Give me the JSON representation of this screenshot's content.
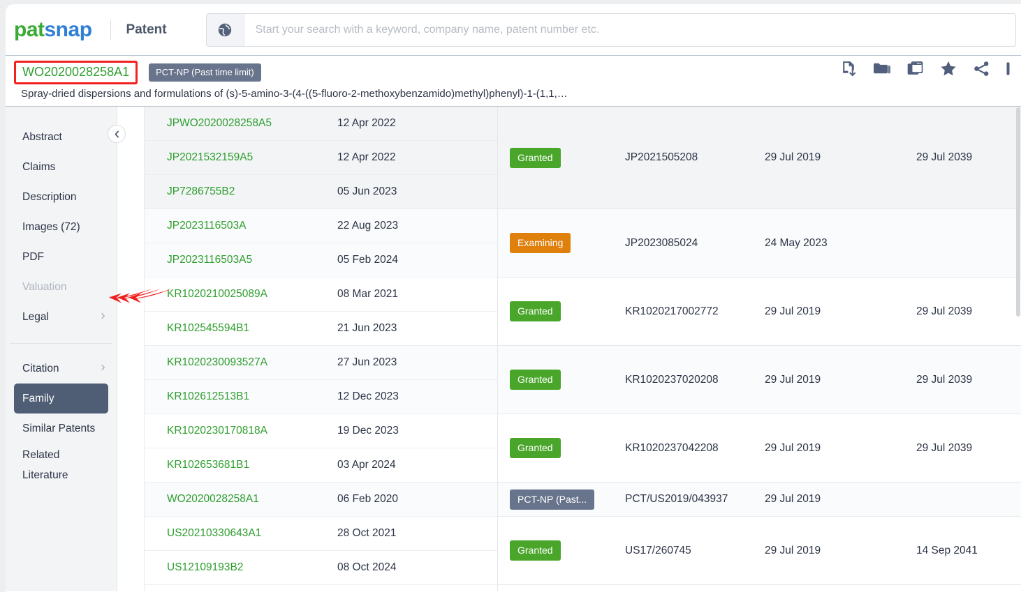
{
  "brand": {
    "pat": "pat",
    "snap": "snap",
    "nav_label": "Patent"
  },
  "search": {
    "placeholder": "Start your search with a keyword, company name, patent number etc.",
    "value": "",
    "globe_icon": "globe-icon"
  },
  "patent_header": {
    "number": "WO2020028258A1",
    "status_chip": "PCT-NP (Past time limit)",
    "title": "Spray-dried dispersions and formulations of (s)-5-amino-3-(4-((5-fluoro-2-methoxybenzamido)methyl)phenyl)-1-(1,1,…",
    "icons": [
      {
        "name": "pdf-download-icon",
        "label": "PDF"
      },
      {
        "name": "folder-icon",
        "label": "Folder"
      },
      {
        "name": "window-copy-icon",
        "label": "Workspace"
      },
      {
        "name": "star-icon",
        "label": "Favorite"
      },
      {
        "name": "share-icon",
        "label": "Share"
      },
      {
        "name": "more-icon",
        "label": "More"
      }
    ]
  },
  "sidebar": {
    "collapse_icon": "chevron-left-icon",
    "items": [
      {
        "label": "Abstract",
        "state": "normal",
        "chevron": false
      },
      {
        "label": "Claims",
        "state": "normal",
        "chevron": false
      },
      {
        "label": "Description",
        "state": "normal",
        "chevron": false
      },
      {
        "label": "Images (72)",
        "state": "normal",
        "chevron": false
      },
      {
        "label": "PDF",
        "state": "normal",
        "chevron": false
      },
      {
        "label": "Valuation",
        "state": "disabled",
        "chevron": false
      },
      {
        "label": "Legal",
        "state": "normal",
        "chevron": true
      }
    ],
    "items2": [
      {
        "label": "Citation",
        "state": "normal",
        "chevron": true
      },
      {
        "label": "Family",
        "state": "active",
        "chevron": false
      },
      {
        "label": "Similar Patents",
        "state": "normal",
        "chevron": false
      },
      {
        "label": "Related Literature",
        "state": "normal",
        "chevron": false,
        "wrap": true
      }
    ]
  },
  "family_table": {
    "publications": [
      {
        "number": "JPWO2020028258A5",
        "date": "12 Apr 2022",
        "arrow": false,
        "shade": "a"
      },
      {
        "number": "JP2021532159A5",
        "date": "12 Apr 2022",
        "arrow": false,
        "shade": "a"
      },
      {
        "number": "JP7286755B2",
        "date": "05 Jun 2023",
        "arrow": true,
        "shade": "a"
      },
      {
        "number": "JP2023116503A",
        "date": "22 Aug 2023",
        "arrow": false,
        "shade": "b"
      },
      {
        "number": "JP2023116503A5",
        "date": "05 Feb 2024",
        "arrow": false,
        "shade": "b"
      },
      {
        "number": "KR1020210025089A",
        "date": "08 Mar 2021",
        "arrow": false,
        "shade": "c"
      },
      {
        "number": "KR102545594B1",
        "date": "21 Jun 2023",
        "arrow": true,
        "shade": "c"
      },
      {
        "number": "KR1020230093527A",
        "date": "27 Jun 2023",
        "arrow": false,
        "shade": "b"
      },
      {
        "number": "KR102612513B1",
        "date": "12 Dec 2023",
        "arrow": false,
        "shade": "b"
      },
      {
        "number": "KR1020230170818A",
        "date": "19 Dec 2023",
        "arrow": false,
        "shade": "c"
      },
      {
        "number": "KR102653681B1",
        "date": "03 Apr 2024",
        "arrow": false,
        "shade": "c"
      },
      {
        "number": "WO2020028258A1",
        "date": "06 Feb 2020",
        "arrow": false,
        "shade": "b"
      },
      {
        "number": "US20210330643A1",
        "date": "28 Oct 2021",
        "arrow": false,
        "shade": "c"
      },
      {
        "number": "US12109193B2",
        "date": "08 Oct 2024",
        "arrow": true,
        "shade": "c"
      }
    ],
    "groups": [
      {
        "status": "Granted",
        "status_type": "granted",
        "application_number": "JP2021505208",
        "filing_date": "29 Jul 2019",
        "expiry_date": "29 Jul 2039",
        "shade": "a"
      },
      {
        "status": "Examining",
        "status_type": "examining",
        "application_number": "JP2023085024",
        "filing_date": "24 May 2023",
        "expiry_date": "",
        "shade": "b"
      },
      {
        "status": "Granted",
        "status_type": "granted",
        "application_number": "KR1020217002772",
        "filing_date": "29 Jul 2019",
        "expiry_date": "29 Jul 2039",
        "shade": "c"
      },
      {
        "status": "Granted",
        "status_type": "granted",
        "application_number": "KR1020237020208",
        "filing_date": "29 Jul 2019",
        "expiry_date": "29 Jul 2039",
        "shade": "b"
      },
      {
        "status": "Granted",
        "status_type": "granted",
        "application_number": "KR1020237042208",
        "filing_date": "29 Jul 2019",
        "expiry_date": "29 Jul 2039",
        "shade": "c"
      },
      {
        "status": "PCT-NP (Past...",
        "status_type": "pct",
        "application_number": "PCT/US2019/043937",
        "filing_date": "29 Jul 2019",
        "expiry_date": "",
        "shade": "b"
      },
      {
        "status": "Granted",
        "status_type": "granted",
        "application_number": "US17/260745",
        "filing_date": "29 Jul 2019",
        "expiry_date": "14 Sep 2041",
        "shade": "c"
      }
    ]
  },
  "colors": {
    "brand_green": "#3caa36",
    "brand_blue": "#2f7fd6",
    "link_green": "#2e9e2e",
    "granted": "#4aa62a",
    "examining": "#df7f0c",
    "pct_gray": "#68748c",
    "active_nav": "#4f5d75",
    "highlight_red": "#f32020"
  }
}
